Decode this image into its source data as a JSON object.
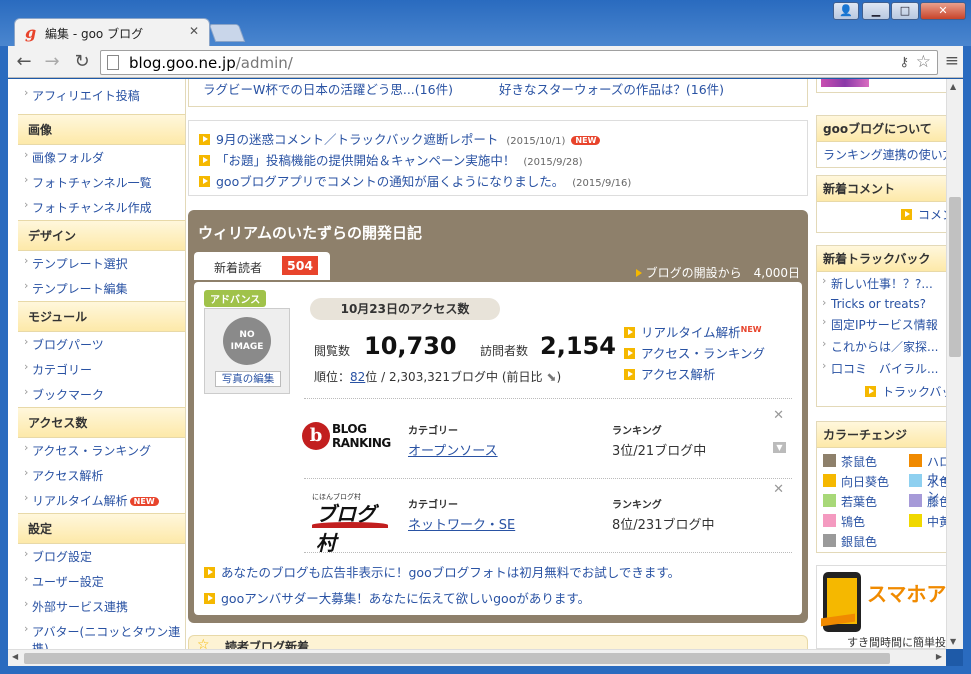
{
  "browser": {
    "tab_title": "編集 - goo ブログ",
    "url_host": "blog.goo.ne.jp",
    "url_path": "/admin/"
  },
  "sidebar": {
    "top_item": "アフィリエイト投稿",
    "sections": [
      {
        "title": "画像",
        "items": [
          {
            "label": "画像フォルダ"
          },
          {
            "label": "フォトチャンネル一覧"
          },
          {
            "label": "フォトチャンネル作成"
          }
        ]
      },
      {
        "title": "デザイン",
        "items": [
          {
            "label": "テンプレート選択"
          },
          {
            "label": "テンプレート編集"
          }
        ]
      },
      {
        "title": "モジュール",
        "items": [
          {
            "label": "ブログパーツ"
          },
          {
            "label": "カテゴリー"
          },
          {
            "label": "ブックマーク"
          }
        ]
      },
      {
        "title": "アクセス数",
        "items": [
          {
            "label": "アクセス・ランキング"
          },
          {
            "label": "アクセス解析"
          },
          {
            "label": "リアルタイム解析",
            "badge": "NEW"
          }
        ]
      },
      {
        "title": "設定",
        "items": [
          {
            "label": "ブログ設定"
          },
          {
            "label": "ユーザー設定"
          },
          {
            "label": "外部サービス連携"
          },
          {
            "label": "アバター(ニコッとタウン連携)"
          }
        ]
      }
    ]
  },
  "top_news": [
    "ラグビーW杯での日本の活躍どう思...(16件)",
    "好きなスターウォーズの作品は？(16件)"
  ],
  "notices": [
    {
      "text": "9月の迷惑コメント／トラックバック遮断レポート",
      "date": "(2015/10/1)",
      "badge": "NEW"
    },
    {
      "text": "「お題」投稿機能の提供開始＆キャンペーン実施中！",
      "date": "(2015/9/28)"
    },
    {
      "text": "gooブログアプリでコメントの通知が届くようになりました。",
      "date": "(2015/9/16)"
    }
  ],
  "dashboard": {
    "blog_title": "ウィリアムのいたずらの開発日記",
    "readers_label": "新着読者",
    "readers_count": "504",
    "since_open": "ブログの開設から　4,000日",
    "advance_badge": "アドバンス",
    "no_image": "NO IMAGE",
    "photo_edit": "写真の編集",
    "access_heading": "10月23日のアクセス数",
    "pageviews_label": "閲覧数",
    "pageviews": "10,730",
    "visitors_label": "訪問者数",
    "visitors": "2,154",
    "rank_prefix": "順位：",
    "rank_value": "82",
    "rank_suffix": "位 / 2,303,321ブログ中 (前日比",
    "rank_close": ")",
    "links": [
      {
        "label": "リアルタイム解析",
        "badge": "NEW"
      },
      {
        "label": "アクセス・ランキング"
      },
      {
        "label": "アクセス解析"
      }
    ],
    "ranking_sites": [
      {
        "logo_line1": "BLOG",
        "logo_line2": "RANKING",
        "logo_mark": "b",
        "category_label": "カテゴリー",
        "category": "オープンソース",
        "rank_label": "ランキング",
        "rank": "3位/21ブログ中"
      },
      {
        "logo_small": "にほんブログ村",
        "logo_big": "ブログ村",
        "category_label": "カテゴリー",
        "category": "ネットワーク・SE",
        "rank_label": "ランキング",
        "rank": "8位/231ブログ中"
      }
    ],
    "promos": [
      "あなたのブログも広告非表示に！gooブログフォトは初月無料でお試しできます。",
      "gooアンバサダー大募集！あなたに伝えて欲しいgooがあります。"
    ]
  },
  "bottom_box_title": "読者ブログ新着",
  "right_sidebar": {
    "about": {
      "title": "gooブログについて",
      "item": "ランキング連携の使い方"
    },
    "comments": {
      "title": "新着コメント",
      "more": "コメント"
    },
    "trackbacks": {
      "title": "新着トラックバック",
      "items": [
        "新しい仕事！？?...",
        "Tricks or treats?",
        "固定IPサービス情報",
        "これからは／家探...",
        "口コミ　バイラル..."
      ],
      "more": "トラックバック"
    },
    "colors": {
      "title": "カラーチェンジ",
      "options": [
        {
          "label": "茶鼠色",
          "color": "#8e806b"
        },
        {
          "label": "ハロウィン",
          "color": "#f08a00"
        },
        {
          "label": "向日葵色",
          "color": "#f5b800"
        },
        {
          "label": "水色",
          "color": "#8ed0f0"
        },
        {
          "label": "若葉色",
          "color": "#a8d878"
        },
        {
          "label": "藤色",
          "color": "#a69ad8"
        },
        {
          "label": "鴇色",
          "color": "#f49ac0"
        },
        {
          "label": "中黄",
          "color": "#f0d800"
        },
        {
          "label": "銀鼠色",
          "color": "#9a9a9a"
        }
      ]
    },
    "smartphone_banner": "スマホア",
    "smartphone_sub": "すき間時間に簡単投稿"
  }
}
